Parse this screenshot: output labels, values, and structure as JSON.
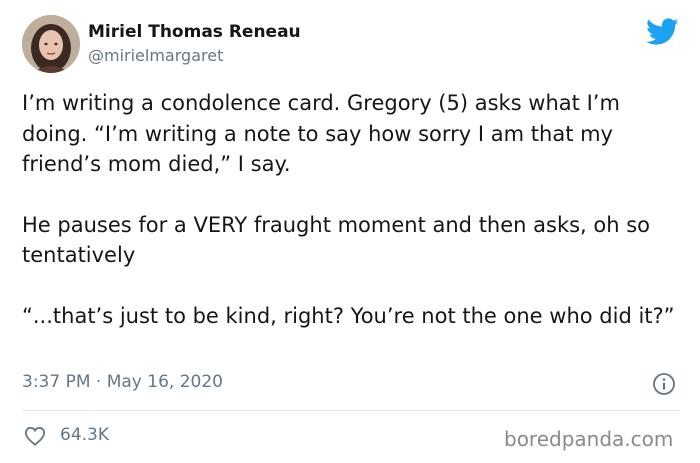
{
  "tweet": {
    "author_name": "Miriel Thomas Reneau",
    "author_handle": "@mirielmargaret",
    "paragraphs": [
      "I’m writing a condolence card. Gregory (5) asks what I’m doing. “I’m writing a note to say how sorry I am that my friend’s mom died,” I say.",
      "He pauses for a VERY fraught moment and then asks, oh so tentatively",
      "“...that’s just to be kind, right? You’re not the one who did it?”"
    ],
    "timestamp": "3:37 PM · May 16, 2020",
    "like_count": "64.3K"
  },
  "watermark": "boredpanda.com",
  "icons": {
    "brand": "twitter-bird-icon",
    "info": "info-icon",
    "like": "heart-icon"
  },
  "colors": {
    "brand_blue": "#1da1f2",
    "text": "#14171a",
    "secondary_text": "#657786",
    "divider": "#e1e8ed"
  }
}
